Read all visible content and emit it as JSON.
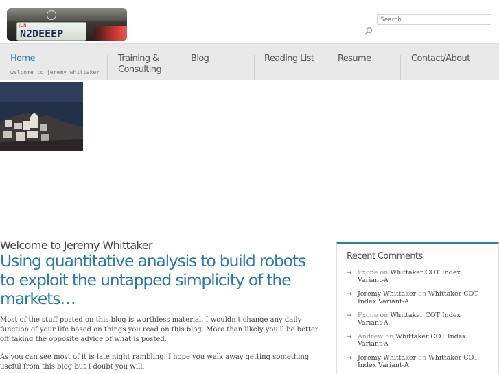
{
  "header": {
    "logo_plate": "N2DEEEP",
    "logo_plate_month": "JUN",
    "search_placeholder": "Search"
  },
  "nav": {
    "items": [
      {
        "label": "Home",
        "sub": "welcome to jeremy whittaker",
        "active": true
      },
      {
        "label": "Training &\nConsulting"
      },
      {
        "label": "Blog"
      },
      {
        "label": "Reading List"
      },
      {
        "label": "Resume"
      },
      {
        "label": "Contact/About"
      }
    ]
  },
  "main": {
    "title": "Welcome to Jeremy Whittaker",
    "tagline": "Using quantitative analysis to build robots to exploit the untapped simplicity of the markets…",
    "paragraphs": [
      "Most of the stuff posted on this blog is worthless material. I wouldn't change any daily function of your life based on things you read on this blog. More than likely you'll be better off taking the opposite advice of what is posted.",
      "As you can see most of it is late night rambling. I hope you walk away getting something useful from this blog but I doubt you will."
    ]
  },
  "sidebar": {
    "title": "Recent Comments",
    "on_word": "on",
    "comments": [
      {
        "author": "Fxone",
        "post": "Whittaker COT Index Variant-A",
        "author_linked": true
      },
      {
        "author": "Jeremy Whittaker",
        "post": "Whittaker COT Index Variant-A",
        "author_linked": false
      },
      {
        "author": "Fxone",
        "post": "Whittaker COT Index Variant-A",
        "author_linked": true
      },
      {
        "author": "Andrew",
        "post": "Whittaker COT Index Variant-A",
        "author_linked": true
      },
      {
        "author": "Jeremy Whittaker",
        "post": "Whittaker COT Index Variant-A",
        "author_linked": false
      }
    ]
  },
  "colors": {
    "accent": "#2a7ba6",
    "nav_bg": "#e9e9e9",
    "text": "#444444"
  }
}
